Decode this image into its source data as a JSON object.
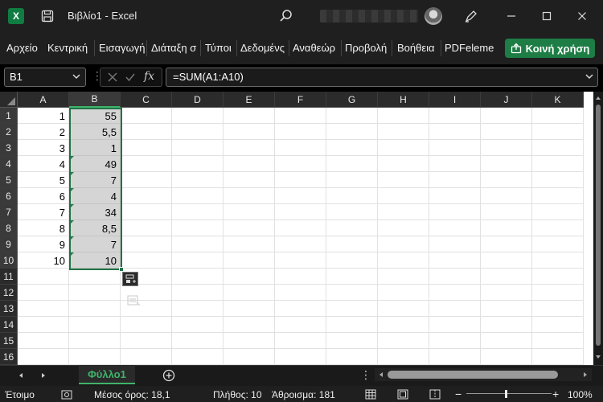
{
  "window": {
    "title": "Βιβλίο1  -  Excel",
    "app_icon": "excel-icon",
    "colors": {
      "accent": "#1e7d45",
      "titlebar": "#1f1f1f",
      "grid_selected": "#d5d5d5"
    }
  },
  "ribbon": {
    "tabs": [
      "Αρχείο",
      "Κεντρική",
      "Εισαγωγή",
      "Διάταξη σ",
      "Τύποι",
      "Δεδομένς",
      "Αναθεώρ",
      "Προβολή",
      "Βοήθεια",
      "PDFeleme"
    ],
    "share_label": "Κοινή χρήση"
  },
  "formula_bar": {
    "name_box": "B1",
    "formula": "=SUM(A1:A10)",
    "fx_label": "fx"
  },
  "grid": {
    "columns": [
      "A",
      "B",
      "C",
      "D",
      "E",
      "F",
      "G",
      "H",
      "I",
      "J",
      "K"
    ],
    "rows": [
      "1",
      "2",
      "3",
      "4",
      "5",
      "6",
      "7",
      "8",
      "9",
      "10",
      "11",
      "12",
      "13",
      "14",
      "15",
      "16"
    ],
    "column_a": [
      "1",
      "2",
      "3",
      "4",
      "5",
      "6",
      "7",
      "8",
      "9",
      "10"
    ],
    "column_b": [
      "55",
      "5,5",
      "1",
      "49",
      "7",
      "4",
      "34",
      "8,5",
      "7",
      "10"
    ]
  },
  "sheets": {
    "active": "Φύλλο1"
  },
  "status_bar": {
    "ready": "Έτοιμο",
    "average": "Μέσος όρος: 18,1",
    "count": "Πλήθος: 10",
    "sum": "Άθροισμα: 181",
    "zoom": "100%"
  }
}
